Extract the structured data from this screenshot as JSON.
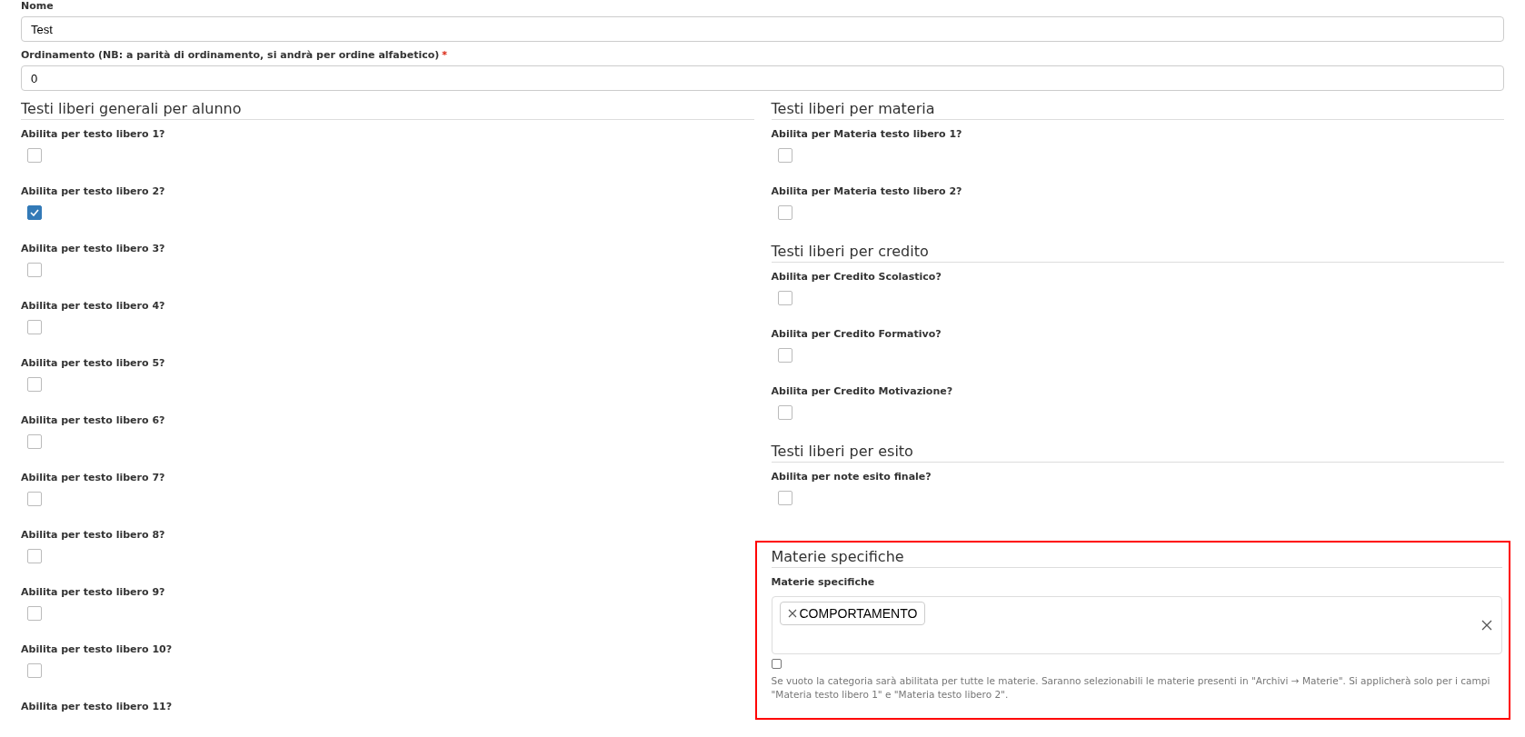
{
  "fields": [
    {
      "label": "Nome",
      "value": "Test"
    },
    {
      "label": "Ordinamento (NB: a parità di ordinamento, si andrà per ordine alfabetico)",
      "required_mark": "*",
      "value": "0"
    }
  ],
  "left_section": {
    "title": "Testi liberi generali per alunno",
    "options": [
      {
        "label": "Abilita per testo libero 1?",
        "checked": false
      },
      {
        "label": "Abilita per testo libero 2?",
        "checked": true
      },
      {
        "label": "Abilita per testo libero 3?",
        "checked": false
      },
      {
        "label": "Abilita per testo libero 4?",
        "checked": false
      },
      {
        "label": "Abilita per testo libero 5?",
        "checked": false
      },
      {
        "label": "Abilita per testo libero 6?",
        "checked": false
      },
      {
        "label": "Abilita per testo libero 7?",
        "checked": false
      },
      {
        "label": "Abilita per testo libero 8?",
        "checked": false
      },
      {
        "label": "Abilita per testo libero 9?",
        "checked": false
      },
      {
        "label": "Abilita per testo libero 10?",
        "checked": false
      },
      {
        "label": "Abilita per testo libero 11?"
      }
    ]
  },
  "right_sections": [
    {
      "title": "Testi liberi per materia",
      "options": [
        {
          "label": "Abilita per Materia testo libero 1?",
          "checked": false
        },
        {
          "label": "Abilita per Materia testo libero 2?",
          "checked": false
        }
      ]
    },
    {
      "title": "Testi liberi per credito",
      "options": [
        {
          "label": "Abilita per Credito Scolastico?",
          "checked": false
        },
        {
          "label": "Abilita per Credito Formativo?",
          "checked": false
        },
        {
          "label": "Abilita per Credito Motivazione?",
          "checked": false
        }
      ]
    },
    {
      "title": "Testi liberi per esito",
      "options": [
        {
          "label": "Abilita per note esito finale?",
          "checked": false
        }
      ]
    }
  ],
  "materie_section": {
    "title": "Materie specifiche",
    "label": "Materie specifiche",
    "tags": [
      "COMPORTAMENTO"
    ],
    "checked": false,
    "help": "Se vuoto la categoria sarà abilitata per tutte le materie. Saranno selezionabili le materie presenti in \"Archivi → Materie\". Si applicherà solo per i campi \"Materia testo libero 1\" e \"Materia testo libero 2\"."
  }
}
